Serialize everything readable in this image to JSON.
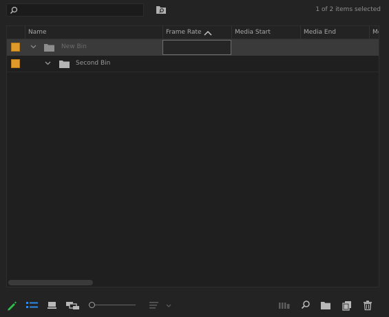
{
  "search": {
    "value": "",
    "placeholder": ""
  },
  "status_text": "1 of 2 items selected",
  "columns": [
    {
      "label": "Name"
    },
    {
      "label": "Frame Rate",
      "sorted": "ascending"
    },
    {
      "label": "Media Start"
    },
    {
      "label": "Media End"
    },
    {
      "label": "Me"
    }
  ],
  "rows": [
    {
      "name": "New Bin",
      "label_color": "#e09a2a",
      "expanded": true,
      "selected": true,
      "depth": 0
    },
    {
      "name": "Second Bin",
      "label_color": "#e09a2a",
      "expanded": true,
      "selected": false,
      "depth": 1
    }
  ],
  "toolbar_icons": [
    "write-on-icon",
    "list-view-icon",
    "icon-view-icon",
    "freeform-view-icon",
    "zoom-slider",
    "sort-icons-icon",
    "automate-to-sequence-icon",
    "find-icon",
    "new-bin-icon",
    "new-item-icon",
    "clear-icon"
  ],
  "colors": {
    "background": "#232323",
    "panel": "#1f1f1f",
    "selected_row": "#3a3a3a",
    "label_orange": "#e09a2a",
    "accent_blue": "#2d8ceb",
    "write_green": "#2fbf4a"
  }
}
